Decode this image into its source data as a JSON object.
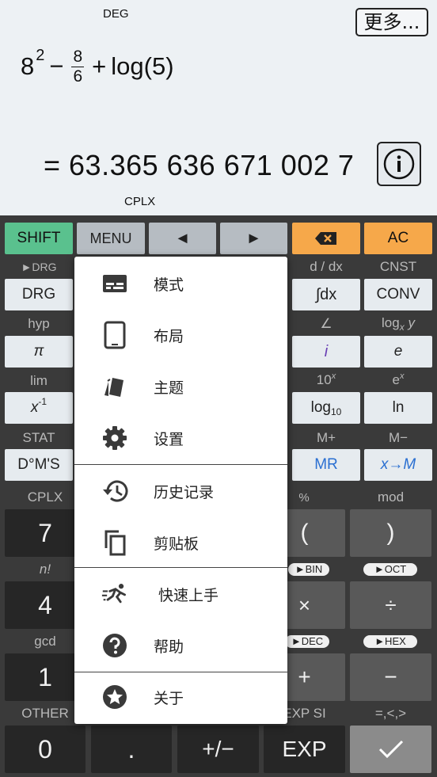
{
  "display": {
    "angle_mode": "DEG",
    "more_button": "更多...",
    "expression": {
      "base": "8",
      "exponent": "2",
      "minus": "−",
      "numerator": "8",
      "denominator": "6",
      "plus": "+",
      "log": "log(5)"
    },
    "result": "= 63.365 636 671 002 7",
    "complex_mode": "CPLX"
  },
  "keys": {
    "shift": "SHIFT",
    "menu": "MENU",
    "left": "◄",
    "right": "►",
    "ac": "AC",
    "drg_label": "►DRG",
    "drg": "DRG",
    "ddx_label": "d / dx",
    "integral": "∫dx",
    "cnst_label": "CNST",
    "conv": "CONV",
    "hyp_label": "hyp",
    "pi": "π",
    "angle_label": "∠",
    "i": "i",
    "logxy_label": "log",
    "logxy_sub": "x",
    "logxy_y": "y",
    "e": "e",
    "lim_label": "lim",
    "inv_base": "x",
    "inv_exp": "-1",
    "tenx_base": "10",
    "tenx_exp": "x",
    "log10_base": "log",
    "log10_sub": "10",
    "ex_base": "e",
    "ex_exp": "x",
    "ln": "ln",
    "stat_label": "STAT",
    "dms": "D°M'S",
    "mplus_label": "M+",
    "mr": "MR",
    "mminus_label": "M−",
    "xtom": "x→M",
    "cplx_label": "CPLX",
    "seven": "7",
    "percent_label": "%",
    "lparen": "(",
    "mod_label": "mod",
    "rparen": ")",
    "fact_label": "n!",
    "four": "4",
    "bin_label": "►BIN",
    "times": "×",
    "oct_label": "►OCT",
    "divide": "÷",
    "gcd_label": "gcd",
    "one": "1",
    "dec_label": "►DEC",
    "plus": "+",
    "hex_label": "►HEX",
    "minus": "−",
    "other_label": "OTHER",
    "zero": "0",
    "dot": ".",
    "negate": "+/−",
    "expsi_label": "EXP SI",
    "exp": "EXP",
    "compare_label": "=,<,>",
    "ok": "✓"
  },
  "menu": {
    "items": [
      {
        "label": "模式",
        "icon": "mode-icon"
      },
      {
        "label": "布局",
        "icon": "tablet-icon"
      },
      {
        "label": "主题",
        "icon": "palette-icon"
      },
      {
        "label": "设置",
        "icon": "gear-icon"
      },
      {
        "label": "历史记录",
        "icon": "history-icon"
      },
      {
        "label": "剪贴板",
        "icon": "clipboard-icon"
      },
      {
        "label": "快速上手",
        "icon": "running-icon"
      },
      {
        "label": "帮助",
        "icon": "help-icon"
      },
      {
        "label": "关于",
        "icon": "star-icon"
      }
    ]
  },
  "colors": {
    "shift": "#5ac18e",
    "ac": "#f6a84a",
    "blue_text": "#2a6fd1",
    "purple_text": "#6a3fb4",
    "display_bg": "#edf1f4",
    "keypad_bg": "#3a3a3a"
  }
}
